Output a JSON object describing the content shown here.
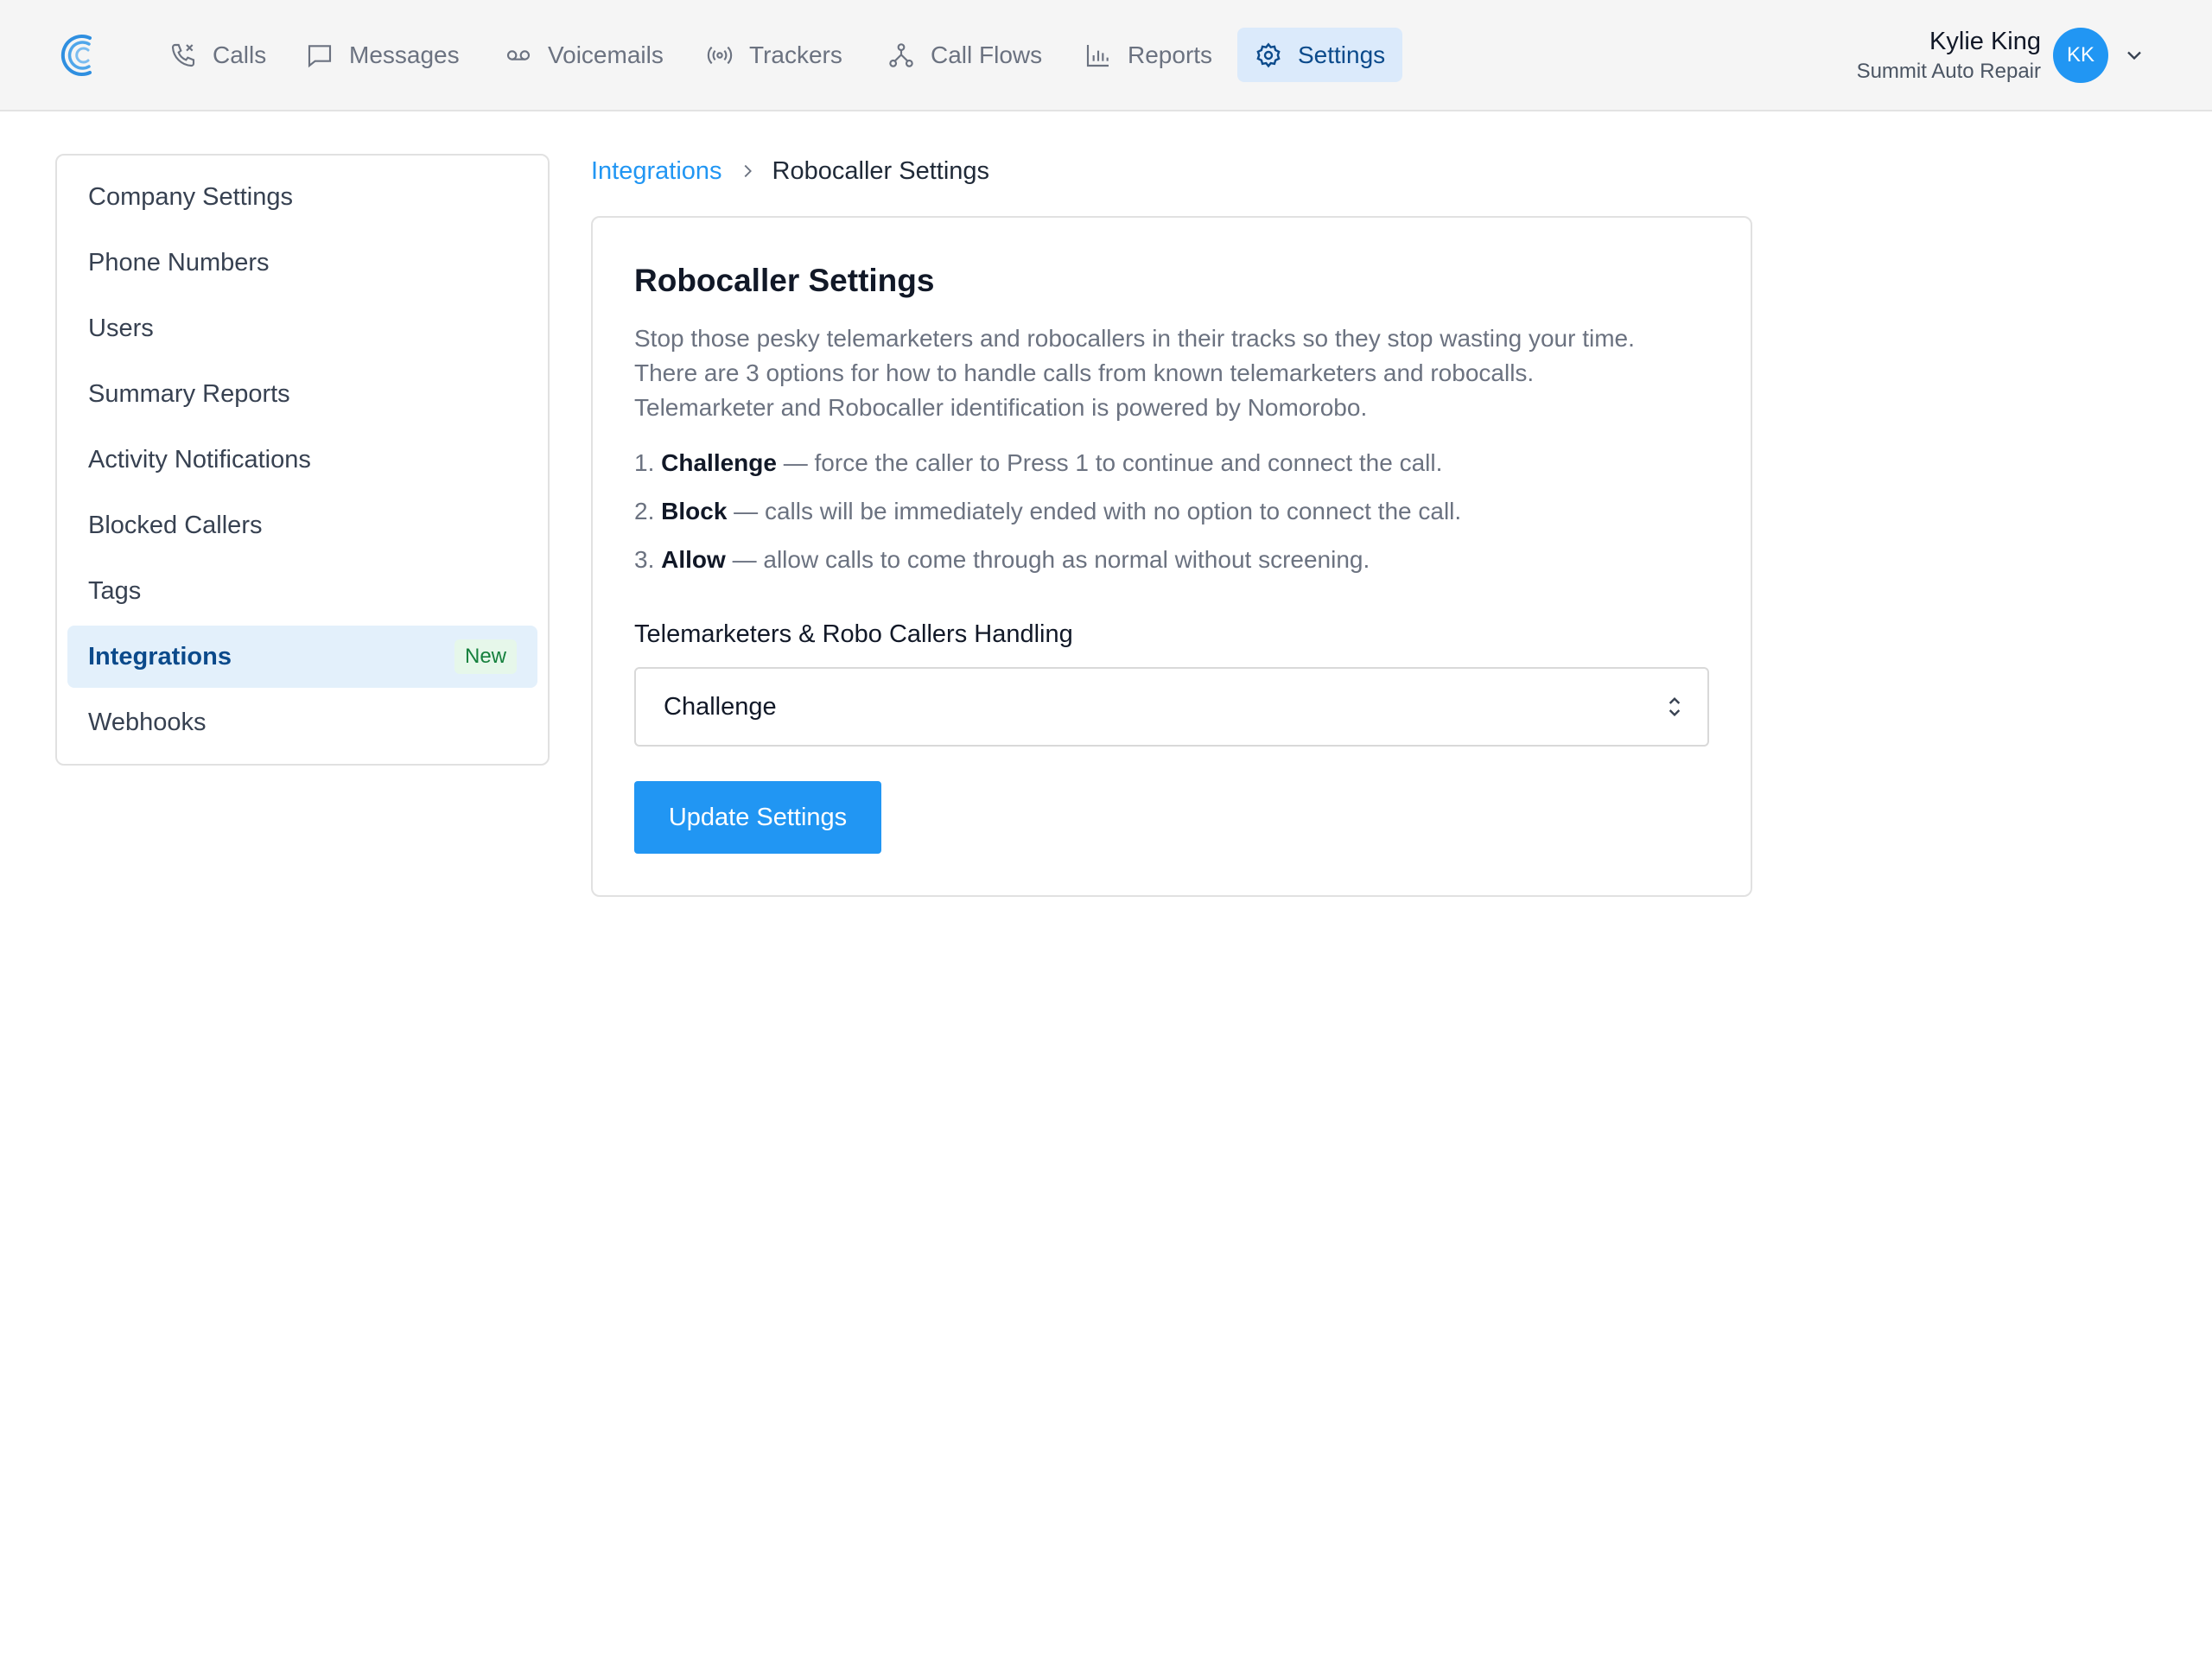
{
  "nav": {
    "items": [
      {
        "label": "Calls",
        "icon": "phone-icon"
      },
      {
        "label": "Messages",
        "icon": "chat-icon"
      },
      {
        "label": "Voicemails",
        "icon": "voicemail-icon"
      },
      {
        "label": "Trackers",
        "icon": "broadcast-icon"
      },
      {
        "label": "Call Flows",
        "icon": "flow-icon"
      },
      {
        "label": "Reports",
        "icon": "bar-chart-icon"
      },
      {
        "label": "Settings",
        "icon": "gear-icon",
        "active": true
      }
    ]
  },
  "user": {
    "name": "Kylie King",
    "company": "Summit Auto Repair",
    "initials": "KK"
  },
  "sidebar": {
    "items": [
      {
        "label": "Company Settings"
      },
      {
        "label": "Phone Numbers"
      },
      {
        "label": "Users"
      },
      {
        "label": "Summary Reports"
      },
      {
        "label": "Activity Notifications"
      },
      {
        "label": "Blocked Callers"
      },
      {
        "label": "Tags"
      },
      {
        "label": "Integrations",
        "active": true,
        "badge": "New"
      },
      {
        "label": "Webhooks"
      }
    ]
  },
  "breadcrumb": {
    "parent": "Integrations",
    "current": "Robocaller Settings"
  },
  "card": {
    "title": "Robocaller Settings",
    "description": [
      "Stop those pesky telemarketers and robocallers in their tracks so they stop wasting your time.",
      "There are 3 options for how to handle calls from known telemarketers and robocalls.",
      "Telemarketer and Robocaller identification is powered by Nomorobo."
    ],
    "options": [
      {
        "number": "1.",
        "name": "Challenge",
        "text": " — force the caller to Press 1 to continue and connect the call."
      },
      {
        "number": "2.",
        "name": "Block",
        "text": " — calls will be immediately ended with no option to connect the call."
      },
      {
        "number": "3.",
        "name": "Allow",
        "text": " — allow calls to come through as normal without screening."
      }
    ],
    "field_label": "Telemarketers & Robo Callers Handling",
    "select_value": "Challenge",
    "button_label": "Update Settings"
  },
  "colors": {
    "accent": "#2196f3",
    "active_nav_bg": "#dbeafb",
    "active_nav_text": "#0b4a8b",
    "badge_bg": "#e6f7ea",
    "badge_text": "#15803d"
  }
}
